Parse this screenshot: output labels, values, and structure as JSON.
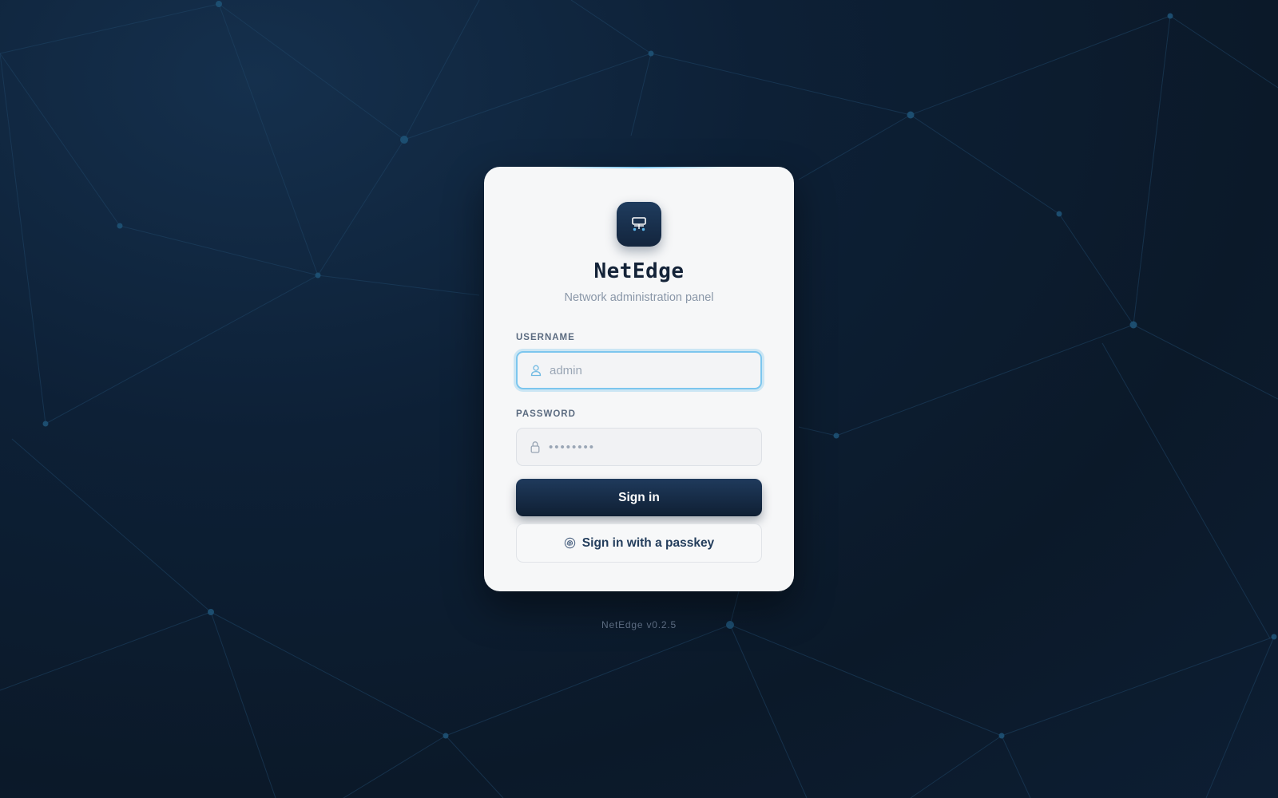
{
  "brand": {
    "logo_icon": "network-server-icon",
    "title": "NetEdge",
    "subtitle": "Network administration panel"
  },
  "form": {
    "username": {
      "label": "USERNAME",
      "icon": "user-icon",
      "placeholder": "admin",
      "value": ""
    },
    "password": {
      "label": "PASSWORD",
      "icon": "lock-icon",
      "placeholder": "••••••••",
      "value": ""
    },
    "signin_label": "Sign in",
    "passkey_label": "Sign in with a passkey",
    "passkey_icon": "fingerprint-icon"
  },
  "footer": {
    "version": "NetEdge v0.2.5"
  },
  "colors": {
    "background": "#0b1929",
    "card": "#f6f7f8",
    "accent": "#7cc6ee",
    "primary_button": "#1f3a5c",
    "title_text": "#142338"
  }
}
